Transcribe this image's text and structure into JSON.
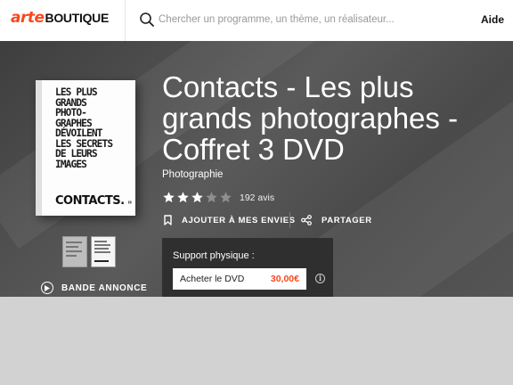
{
  "header": {
    "logo_brand": "arte",
    "logo_suffix": "BOUTIQUE",
    "search_placeholder": "Chercher un programme, un thème, un réalisateur...",
    "help_label": "Aide"
  },
  "product": {
    "title": "Contacts - Les plus grands photographes - Coffret 3 DVD",
    "category": "Photographie",
    "rating": 3,
    "rating_max": 5,
    "reviews_label": "192 avis",
    "cover": {
      "lines": [
        "LES PLUS",
        "GRANDS",
        "PHOTO-",
        "GRAPHES",
        "DÉVOILENT",
        "LES SECRETS",
        "DE LEURS",
        "IMAGES"
      ],
      "brand": "CONTACTS."
    },
    "trailer_label": "BANDE ANNONCE",
    "wishlist_label": "AJOUTER À MES ENVIES",
    "share_label": "PARTAGER"
  },
  "purchase": {
    "support_label": "Support physique :",
    "offer_label": "Acheter le DVD",
    "offer_price": "30,00€"
  },
  "colors": {
    "accent": "#fa481c",
    "star_on": "#ffffff",
    "star_off": "#8f8f8f"
  }
}
